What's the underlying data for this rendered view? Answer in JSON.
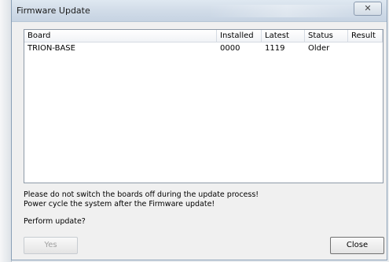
{
  "window": {
    "title": "Firmware Update",
    "close_glyph": "✕"
  },
  "table": {
    "headers": [
      "Board",
      "Installed",
      "Latest",
      "Status",
      "Result"
    ],
    "rows": [
      {
        "board": "TRION-BASE",
        "installed": "0000",
        "latest": "1119",
        "status": "Older",
        "result": ""
      }
    ]
  },
  "messages": {
    "line1": "Please do not switch the boards off during the update process!",
    "line2": "Power cycle the system after the Firmware update!",
    "prompt": "Perform update?"
  },
  "buttons": {
    "yes": "Yes",
    "close": "Close"
  },
  "icons": {
    "close": "close-icon"
  }
}
